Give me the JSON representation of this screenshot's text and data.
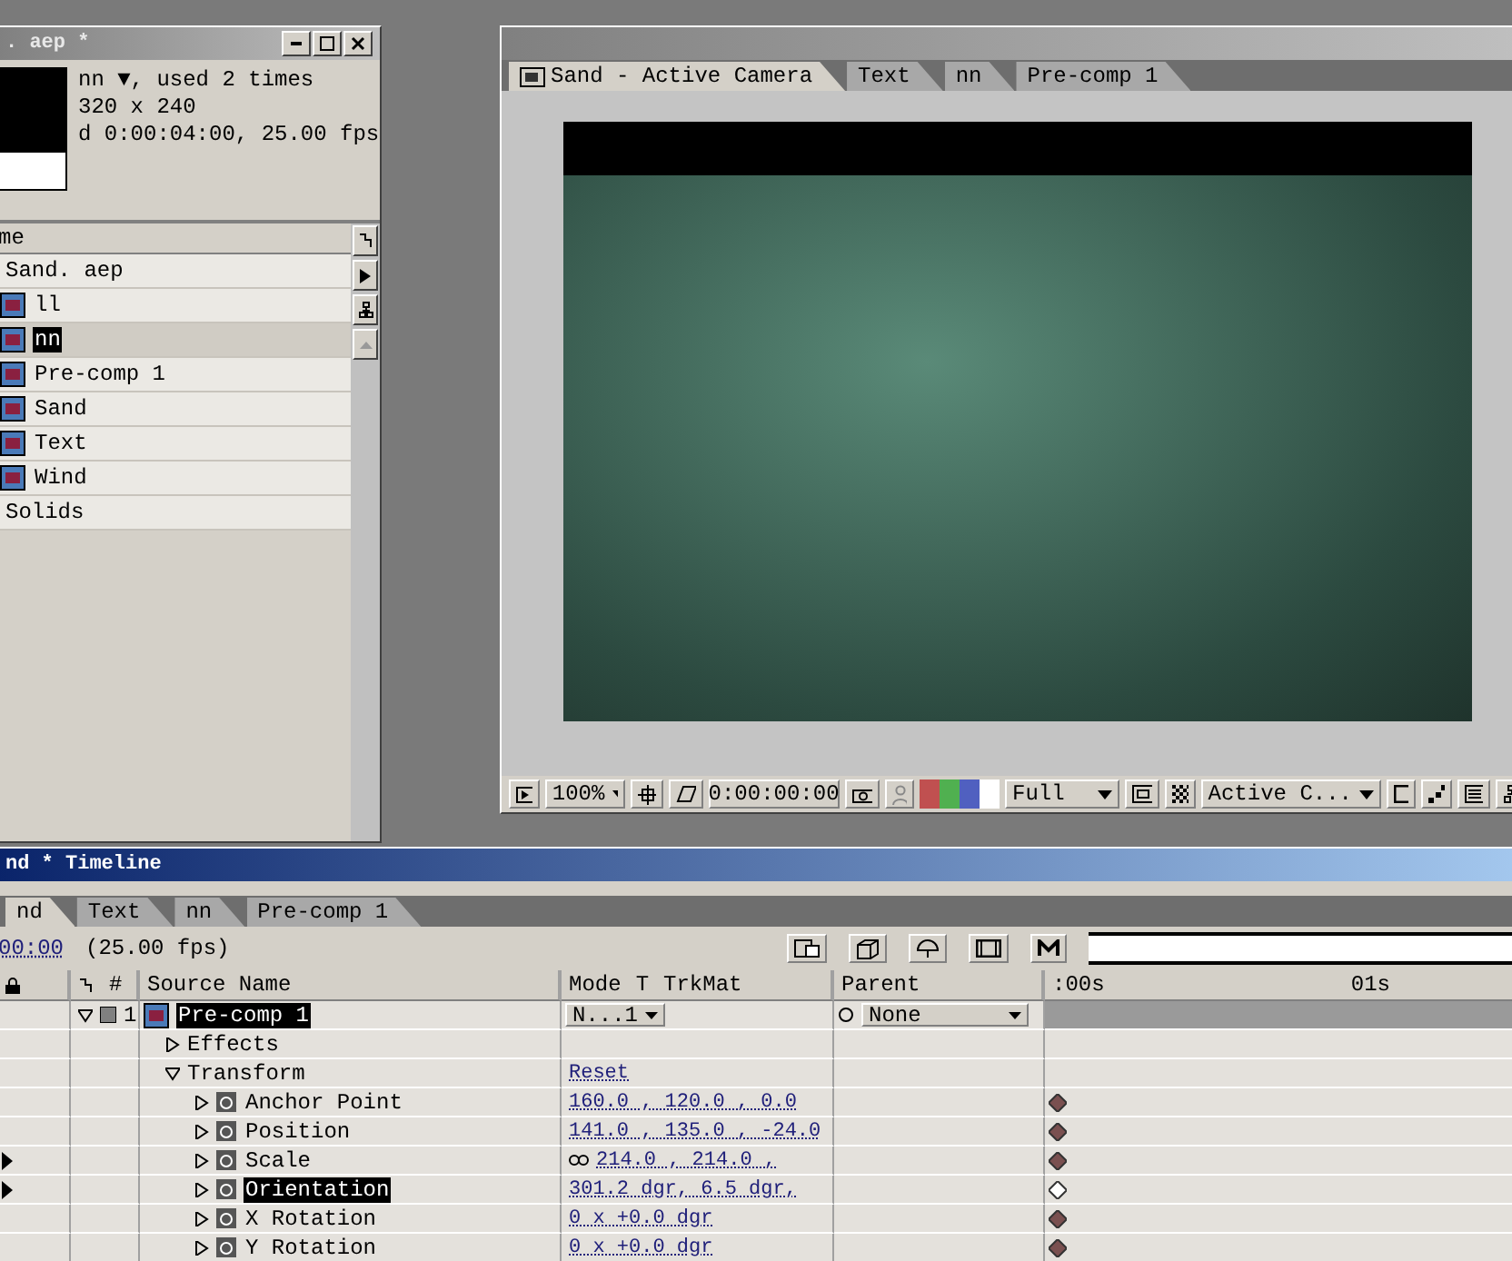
{
  "project": {
    "title": ". aep *",
    "info": [
      "nn ▼, used 2 times",
      "320 x 240",
      "d 0:00:04:00, 25.00 fps"
    ],
    "column": "me",
    "items": [
      {
        "label": "Sand. aep",
        "kind": "plain",
        "selected": false
      },
      {
        "label": "ll",
        "kind": "comp",
        "selected": false
      },
      {
        "label": "nn",
        "kind": "comp",
        "selected": true
      },
      {
        "label": "Pre-comp 1",
        "kind": "comp",
        "selected": false
      },
      {
        "label": "Sand",
        "kind": "comp",
        "selected": false
      },
      {
        "label": "Text",
        "kind": "comp",
        "selected": false
      },
      {
        "label": "Wind",
        "kind": "comp",
        "selected": false
      },
      {
        "label": "Solids",
        "kind": "plain",
        "selected": false
      }
    ]
  },
  "composition": {
    "tabs": [
      {
        "label": "Sand - Active Camera",
        "selected": true
      },
      {
        "label": "Text",
        "selected": false
      },
      {
        "label": "nn",
        "selected": false
      },
      {
        "label": "Pre-comp 1",
        "selected": false
      }
    ],
    "toolbar": {
      "zoom": "100%",
      "time": "0:00:00:00",
      "resolution": "Full",
      "view": "Active C..."
    }
  },
  "timeline": {
    "title": "nd * Timeline",
    "tabs": [
      {
        "label": "nd",
        "selected": true
      },
      {
        "label": "Text",
        "selected": false
      },
      {
        "label": "nn",
        "selected": false
      },
      {
        "label": "Pre-comp 1",
        "selected": false
      }
    ],
    "time": "00:00",
    "fps": "(25.00 fps)",
    "columns": {
      "number": "#",
      "source": "Source Name",
      "mode": "Mode",
      "t": "T",
      "trkmat": "TrkMat",
      "parent": "Parent"
    },
    "ruler": [
      ":00s",
      "01s"
    ],
    "layer": {
      "number": "1",
      "name": "Pre-comp 1",
      "selected": true,
      "mode": "N...1",
      "parent": "None"
    },
    "groups": [
      {
        "label": "Effects",
        "expanded": false
      },
      {
        "label": "Transform",
        "expanded": true,
        "value": "Reset",
        "children": [
          {
            "label": "Anchor Point",
            "value": "160.0 , 120.0 , 0.0",
            "selected": false,
            "navigator": false,
            "linked": false
          },
          {
            "label": "Position",
            "value": "141.0 , 135.0 , -24.0",
            "selected": false,
            "navigator": false,
            "linked": false
          },
          {
            "label": "Scale",
            "value": "214.0 , 214.0 ,",
            "selected": false,
            "navigator": true,
            "linked": true
          },
          {
            "label": "Orientation",
            "value": "301.2 dgr, 6.5 dgr,",
            "selected": true,
            "navigator": true,
            "linked": false
          },
          {
            "label": "X Rotation",
            "value": "0 x +0.0 dgr",
            "selected": false,
            "navigator": false,
            "linked": false
          },
          {
            "label": "Y Rotation",
            "value": "0 x +0.0 dgr",
            "selected": false,
            "navigator": false,
            "linked": false
          }
        ]
      }
    ]
  }
}
